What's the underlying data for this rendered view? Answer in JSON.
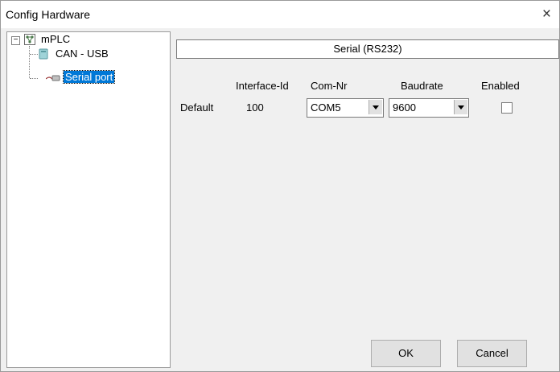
{
  "window": {
    "title": "Config Hardware",
    "close_glyph": "×"
  },
  "tree": {
    "expander_glyph": "−",
    "root": {
      "label": "mPLC",
      "icon": "network-icon"
    },
    "children": [
      {
        "label": "CAN - USB",
        "icon": "can-device-icon"
      },
      {
        "label": "Serial port",
        "icon": "serial-cable-icon",
        "selected": true
      }
    ]
  },
  "panel": {
    "header": "Serial (RS232)",
    "columns": [
      "Interface-Id",
      "Com-Nr",
      "Baudrate",
      "Enabled"
    ],
    "row": {
      "name": "Default",
      "interface_id": "100",
      "com_nr": "COM5",
      "baudrate": "9600",
      "enabled": false
    }
  },
  "buttons": {
    "ok": "OK",
    "cancel": "Cancel"
  },
  "colors": {
    "selection": "#0078d7",
    "background": "#f0f0f0"
  }
}
